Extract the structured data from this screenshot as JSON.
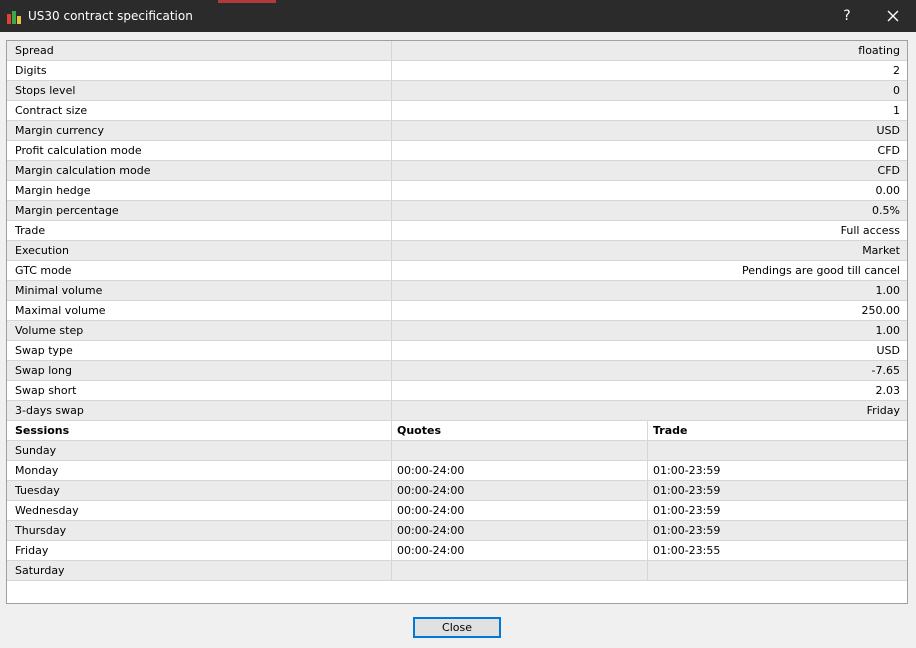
{
  "window": {
    "title": "US30 contract specification",
    "help_label": "?",
    "close_icon": "close-icon"
  },
  "specs": [
    {
      "name": "Spread",
      "value": "floating"
    },
    {
      "name": "Digits",
      "value": "2"
    },
    {
      "name": "Stops level",
      "value": "0"
    },
    {
      "name": "Contract size",
      "value": "1"
    },
    {
      "name": "Margin currency",
      "value": "USD"
    },
    {
      "name": "Profit calculation mode",
      "value": "CFD"
    },
    {
      "name": "Margin calculation mode",
      "value": "CFD"
    },
    {
      "name": "Margin hedge",
      "value": "0.00"
    },
    {
      "name": "Margin percentage",
      "value": "0.5%"
    },
    {
      "name": "Trade",
      "value": "Full access"
    },
    {
      "name": "Execution",
      "value": "Market"
    },
    {
      "name": "GTC mode",
      "value": "Pendings are good till cancel"
    },
    {
      "name": "Minimal volume",
      "value": "1.00"
    },
    {
      "name": "Maximal volume",
      "value": "250.00"
    },
    {
      "name": "Volume step",
      "value": "1.00"
    },
    {
      "name": "Swap type",
      "value": "USD"
    },
    {
      "name": "Swap long",
      "value": "-7.65"
    },
    {
      "name": "Swap short",
      "value": "2.03"
    },
    {
      "name": "3-days swap",
      "value": "Friday"
    }
  ],
  "sessions": {
    "headers": {
      "day": "Sessions",
      "quotes": "Quotes",
      "trade": "Trade"
    },
    "rows": [
      {
        "day": "Sunday",
        "quotes": "",
        "trade": ""
      },
      {
        "day": "Monday",
        "quotes": "00:00-24:00",
        "trade": "01:00-23:59"
      },
      {
        "day": "Tuesday",
        "quotes": "00:00-24:00",
        "trade": "01:00-23:59"
      },
      {
        "day": "Wednesday",
        "quotes": "00:00-24:00",
        "trade": "01:00-23:59"
      },
      {
        "day": "Thursday",
        "quotes": "00:00-24:00",
        "trade": "01:00-23:59"
      },
      {
        "day": "Friday",
        "quotes": "00:00-24:00",
        "trade": "01:00-23:55"
      },
      {
        "day": "Saturday",
        "quotes": "",
        "trade": ""
      }
    ]
  },
  "footer": {
    "close_label": "Close"
  },
  "colors": {
    "titlebar": "#2b2b2b",
    "row_alt": "#ebebeb",
    "button_focus": "#0078d7"
  }
}
